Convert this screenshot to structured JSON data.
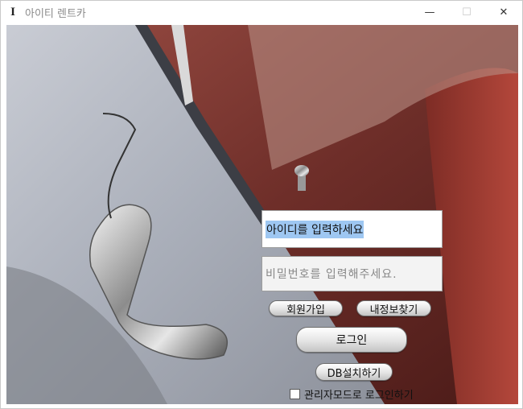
{
  "window": {
    "title": "아이티 렌트카",
    "app_icon": "I",
    "controls": {
      "minimize": "—",
      "maximize": "☐",
      "close": "✕"
    }
  },
  "login": {
    "id_value": "아이디를 입력하세요",
    "password_placeholder": "비밀번호를 입력해주세요.",
    "signup_label": "회원가입",
    "find_info_label": "내정보찾기",
    "login_label": "로그인",
    "db_setup_label": "DB설치하기",
    "admin_mode_label": "관리자모드로 로그인하기",
    "admin_mode_checked": false
  },
  "background": {
    "subject": "car-door-handle-photo"
  }
}
